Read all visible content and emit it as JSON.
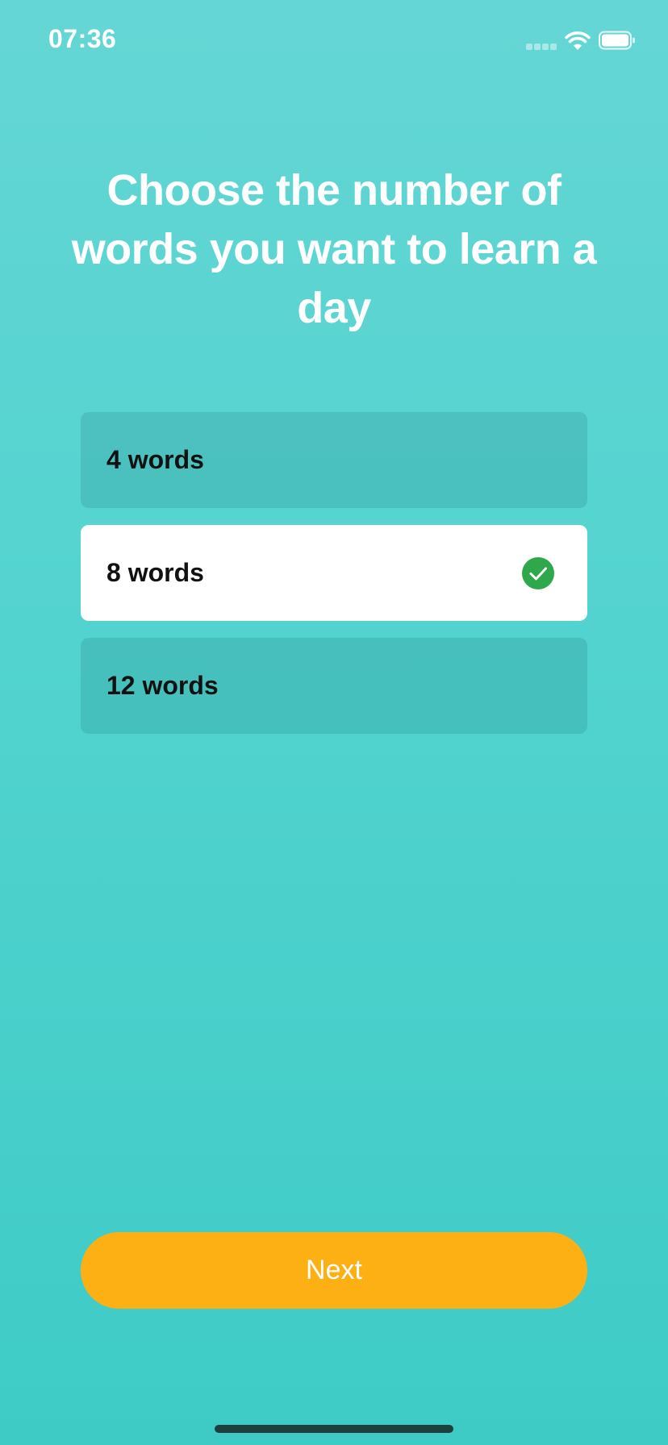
{
  "status_bar": {
    "time": "07:36"
  },
  "onboarding": {
    "title": "Choose the number of words you want to learn a day",
    "options": [
      {
        "label": "4 words",
        "selected": false
      },
      {
        "label": "8 words",
        "selected": true
      },
      {
        "label": "12 words",
        "selected": false
      }
    ],
    "next_label": "Next"
  },
  "icons": {
    "check": "check-circle-icon",
    "wifi": "wifi-icon",
    "battery": "battery-icon",
    "signal": "cellular-signal-icon"
  },
  "colors": {
    "accent": "#fdb014",
    "check": "#2ea84a",
    "background_top": "#64d6d5",
    "background_bottom": "#3ecbc6"
  }
}
